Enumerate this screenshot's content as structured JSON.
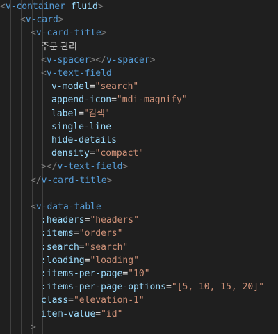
{
  "editor": {
    "lines": [
      [
        {
          "t": "<",
          "c": "punc"
        },
        {
          "t": "v-container",
          "c": "tag"
        },
        {
          "t": " ",
          "c": "text"
        },
        {
          "t": "fluid",
          "c": "attr"
        },
        {
          "t": ">",
          "c": "punc"
        }
      ],
      [
        {
          "t": "<",
          "c": "punc"
        },
        {
          "t": "v-card",
          "c": "tag"
        },
        {
          "t": ">",
          "c": "punc"
        }
      ],
      [
        {
          "t": "<",
          "c": "punc"
        },
        {
          "t": "v-card-title",
          "c": "tag"
        },
        {
          "t": ">",
          "c": "punc"
        }
      ],
      [
        {
          "t": "주문 관리",
          "c": "text"
        }
      ],
      [
        {
          "t": "<",
          "c": "punc"
        },
        {
          "t": "v-spacer",
          "c": "tag"
        },
        {
          "t": "></",
          "c": "punc"
        },
        {
          "t": "v-spacer",
          "c": "tag"
        },
        {
          "t": ">",
          "c": "punc"
        }
      ],
      [
        {
          "t": "<",
          "c": "punc"
        },
        {
          "t": "v-text-field",
          "c": "tag"
        }
      ],
      [
        {
          "t": "v-model",
          "c": "attr"
        },
        {
          "t": "=",
          "c": "text"
        },
        {
          "t": "\"search\"",
          "c": "str"
        }
      ],
      [
        {
          "t": "append-icon",
          "c": "attr"
        },
        {
          "t": "=",
          "c": "text"
        },
        {
          "t": "\"mdi-magnify\"",
          "c": "str"
        }
      ],
      [
        {
          "t": "label",
          "c": "attr"
        },
        {
          "t": "=",
          "c": "text"
        },
        {
          "t": "\"검색\"",
          "c": "str"
        }
      ],
      [
        {
          "t": "single-line",
          "c": "attr"
        }
      ],
      [
        {
          "t": "hide-details",
          "c": "attr"
        }
      ],
      [
        {
          "t": "density",
          "c": "attr"
        },
        {
          "t": "=",
          "c": "text"
        },
        {
          "t": "\"compact\"",
          "c": "str"
        }
      ],
      [
        {
          "t": "></",
          "c": "punc"
        },
        {
          "t": "v-text-field",
          "c": "tag"
        },
        {
          "t": ">",
          "c": "punc"
        }
      ],
      [
        {
          "t": "</",
          "c": "punc"
        },
        {
          "t": "v-card-title",
          "c": "tag"
        },
        {
          "t": ">",
          "c": "punc"
        }
      ],
      [],
      [
        {
          "t": "<",
          "c": "punc"
        },
        {
          "t": "v-data-table",
          "c": "tag"
        }
      ],
      [
        {
          "t": ":headers",
          "c": "attr"
        },
        {
          "t": "=",
          "c": "text"
        },
        {
          "t": "\"headers\"",
          "c": "str"
        }
      ],
      [
        {
          "t": ":items",
          "c": "attr"
        },
        {
          "t": "=",
          "c": "text"
        },
        {
          "t": "\"orders\"",
          "c": "str"
        }
      ],
      [
        {
          "t": ":search",
          "c": "attr"
        },
        {
          "t": "=",
          "c": "text"
        },
        {
          "t": "\"search\"",
          "c": "str"
        }
      ],
      [
        {
          "t": ":loading",
          "c": "attr"
        },
        {
          "t": "=",
          "c": "text"
        },
        {
          "t": "\"loading\"",
          "c": "str"
        }
      ],
      [
        {
          "t": ":items-per-page",
          "c": "attr"
        },
        {
          "t": "=",
          "c": "text"
        },
        {
          "t": "\"10\"",
          "c": "str"
        }
      ],
      [
        {
          "t": ":items-per-page-options",
          "c": "attr"
        },
        {
          "t": "=",
          "c": "text"
        },
        {
          "t": "\"[5, 10, 15, 20]\"",
          "c": "str"
        }
      ],
      [
        {
          "t": "class",
          "c": "attr"
        },
        {
          "t": "=",
          "c": "text"
        },
        {
          "t": "\"elevation-1\"",
          "c": "str"
        }
      ],
      [
        {
          "t": "item-value",
          "c": "attr"
        },
        {
          "t": "=",
          "c": "text"
        },
        {
          "t": "\"id\"",
          "c": "str"
        }
      ],
      [
        {
          "t": ">",
          "c": "punc"
        }
      ]
    ],
    "colors": {
      "background": "#1f1f1f",
      "tag": "#569cd6",
      "attribute": "#9cdcfe",
      "string": "#ce9178",
      "punctuation": "#808080",
      "text": "#d4d4d4"
    }
  }
}
